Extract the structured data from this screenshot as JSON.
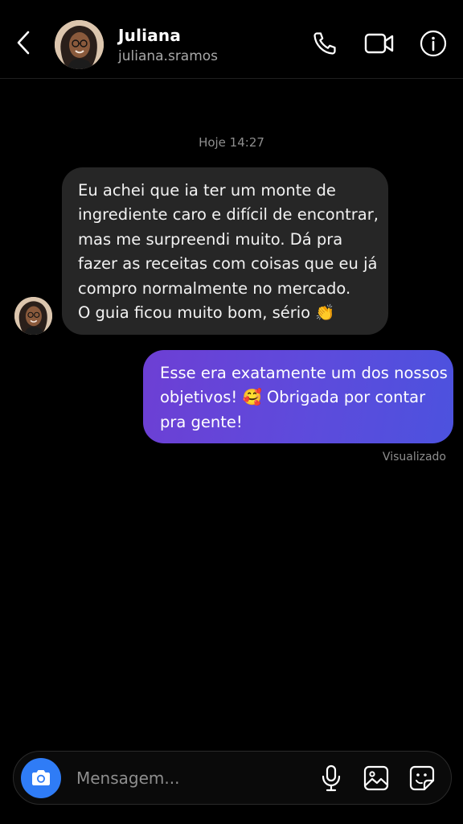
{
  "header": {
    "contact_name": "Juliana",
    "username": "juliana.sramos",
    "icons": [
      "back-icon",
      "phone-icon",
      "video-camera-icon",
      "info-icon"
    ]
  },
  "thread": {
    "timestamp": "Hoje 14:27",
    "messages": [
      {
        "from": "contact",
        "lines": [
          "Eu achei que ia ter um monte de",
          "ingrediente caro e difícil de encontrar,",
          "mas me surpreendi muito. Dá pra",
          "fazer as receitas com coisas que eu já",
          "compro normalmente no mercado.",
          "O guia ficou muito bom, sério"
        ],
        "emoji": "👏"
      },
      {
        "from": "me",
        "line1": "Esse era exatamente um dos nossos",
        "line2_before": "objetivos!",
        "line2_emoji": "🥰",
        "line2_after": "Obrigada por contar",
        "line3": "pra gente!"
      }
    ],
    "seen_label": "Visualizado"
  },
  "composer": {
    "placeholder": "Mensagem...",
    "icons": [
      "camera-icon",
      "microphone-icon",
      "gallery-icon",
      "sticker-icon"
    ]
  },
  "colors": {
    "background": "#000000",
    "incoming_bubble": "#262626",
    "outgoing_gradient_start": "#6d3fd4",
    "outgoing_gradient_end": "#4c52de",
    "camera_button": "#2f7cf6",
    "secondary_text": "#8e8e8e"
  }
}
